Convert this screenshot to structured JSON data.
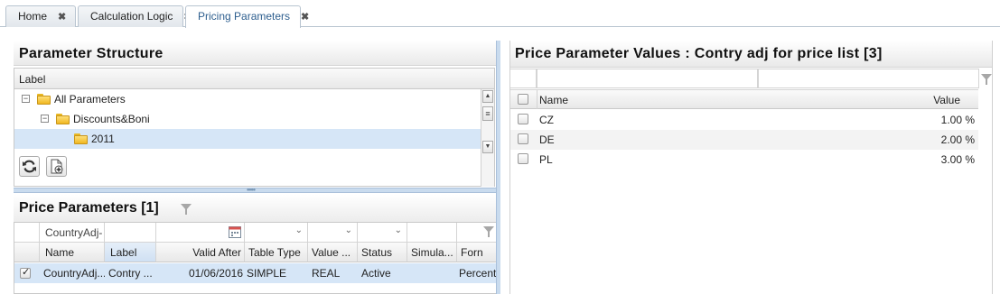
{
  "tabs": [
    {
      "label": "Home"
    },
    {
      "label": "Calculation Logic"
    },
    {
      "label": "Pricing Parameters"
    }
  ],
  "tab_close_glyph": "✖",
  "parameter_structure": {
    "title": "Parameter Structure",
    "column_label": "Label",
    "nodes": [
      {
        "label": "All Parameters"
      },
      {
        "label": "Discounts&Boni"
      },
      {
        "label": "2011"
      }
    ]
  },
  "price_parameters": {
    "title": "Price Parameters [1]",
    "filter_name_value": "CountryAdj-",
    "columns": [
      "Name",
      "Label",
      "Valid After",
      "Table Type",
      "Value ...",
      "Status",
      "Simula...",
      "Forn"
    ],
    "rows": [
      {
        "name": "CountryAdj...",
        "label": "Contry ...",
        "valid_after": "01/06/2016",
        "table_type": "SIMPLE",
        "value_type": "REAL",
        "status": "Active",
        "simulation": "",
        "format": "Percent"
      }
    ]
  },
  "price_parameter_values": {
    "title": "Price Parameter Values : Contry adj for price list [3]",
    "columns": {
      "name": "Name",
      "value": "Value"
    },
    "rows": [
      {
        "name": "CZ",
        "value": "1.00 %"
      },
      {
        "name": "DE",
        "value": "2.00 %"
      },
      {
        "name": "PL",
        "value": "3.00 %"
      }
    ]
  },
  "colors": {
    "accent": "#2d5e8e",
    "selection": "#d6e6f7",
    "splitter": "#c9dbee"
  },
  "icons": [
    "close-icon",
    "folder-icon",
    "collapse-icon",
    "refresh-icon",
    "add-document-icon",
    "filter-icon",
    "calendar-icon",
    "chevron-down-icon"
  ]
}
